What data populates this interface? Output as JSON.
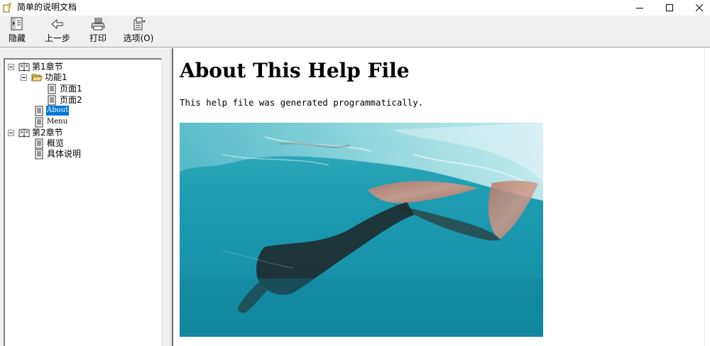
{
  "window": {
    "title": "简单的说明文档",
    "app_icon": "help-book-question-icon",
    "controls": {
      "minimize": "minimize-icon",
      "maximize": "maximize-icon",
      "close": "close-icon"
    }
  },
  "toolbar": {
    "hide_label": "隐藏",
    "back_label": "上一步",
    "print_label": "打印",
    "options_label": "选项(O)"
  },
  "tree": {
    "chapter1": "第1章节",
    "feature1": "功能1",
    "page1": "页面1",
    "page2": "页面2",
    "about": "About",
    "menu": "Menu",
    "chapter2": "第2章节",
    "overview": "概览",
    "details": "具体说明"
  },
  "content": {
    "heading": "About This Help File",
    "paragraph": "This help file was generated programmatically."
  },
  "colors": {
    "selection": "#0078d7",
    "toolbar_bg": "#f0f0f0",
    "water": "#1fa3b7"
  }
}
